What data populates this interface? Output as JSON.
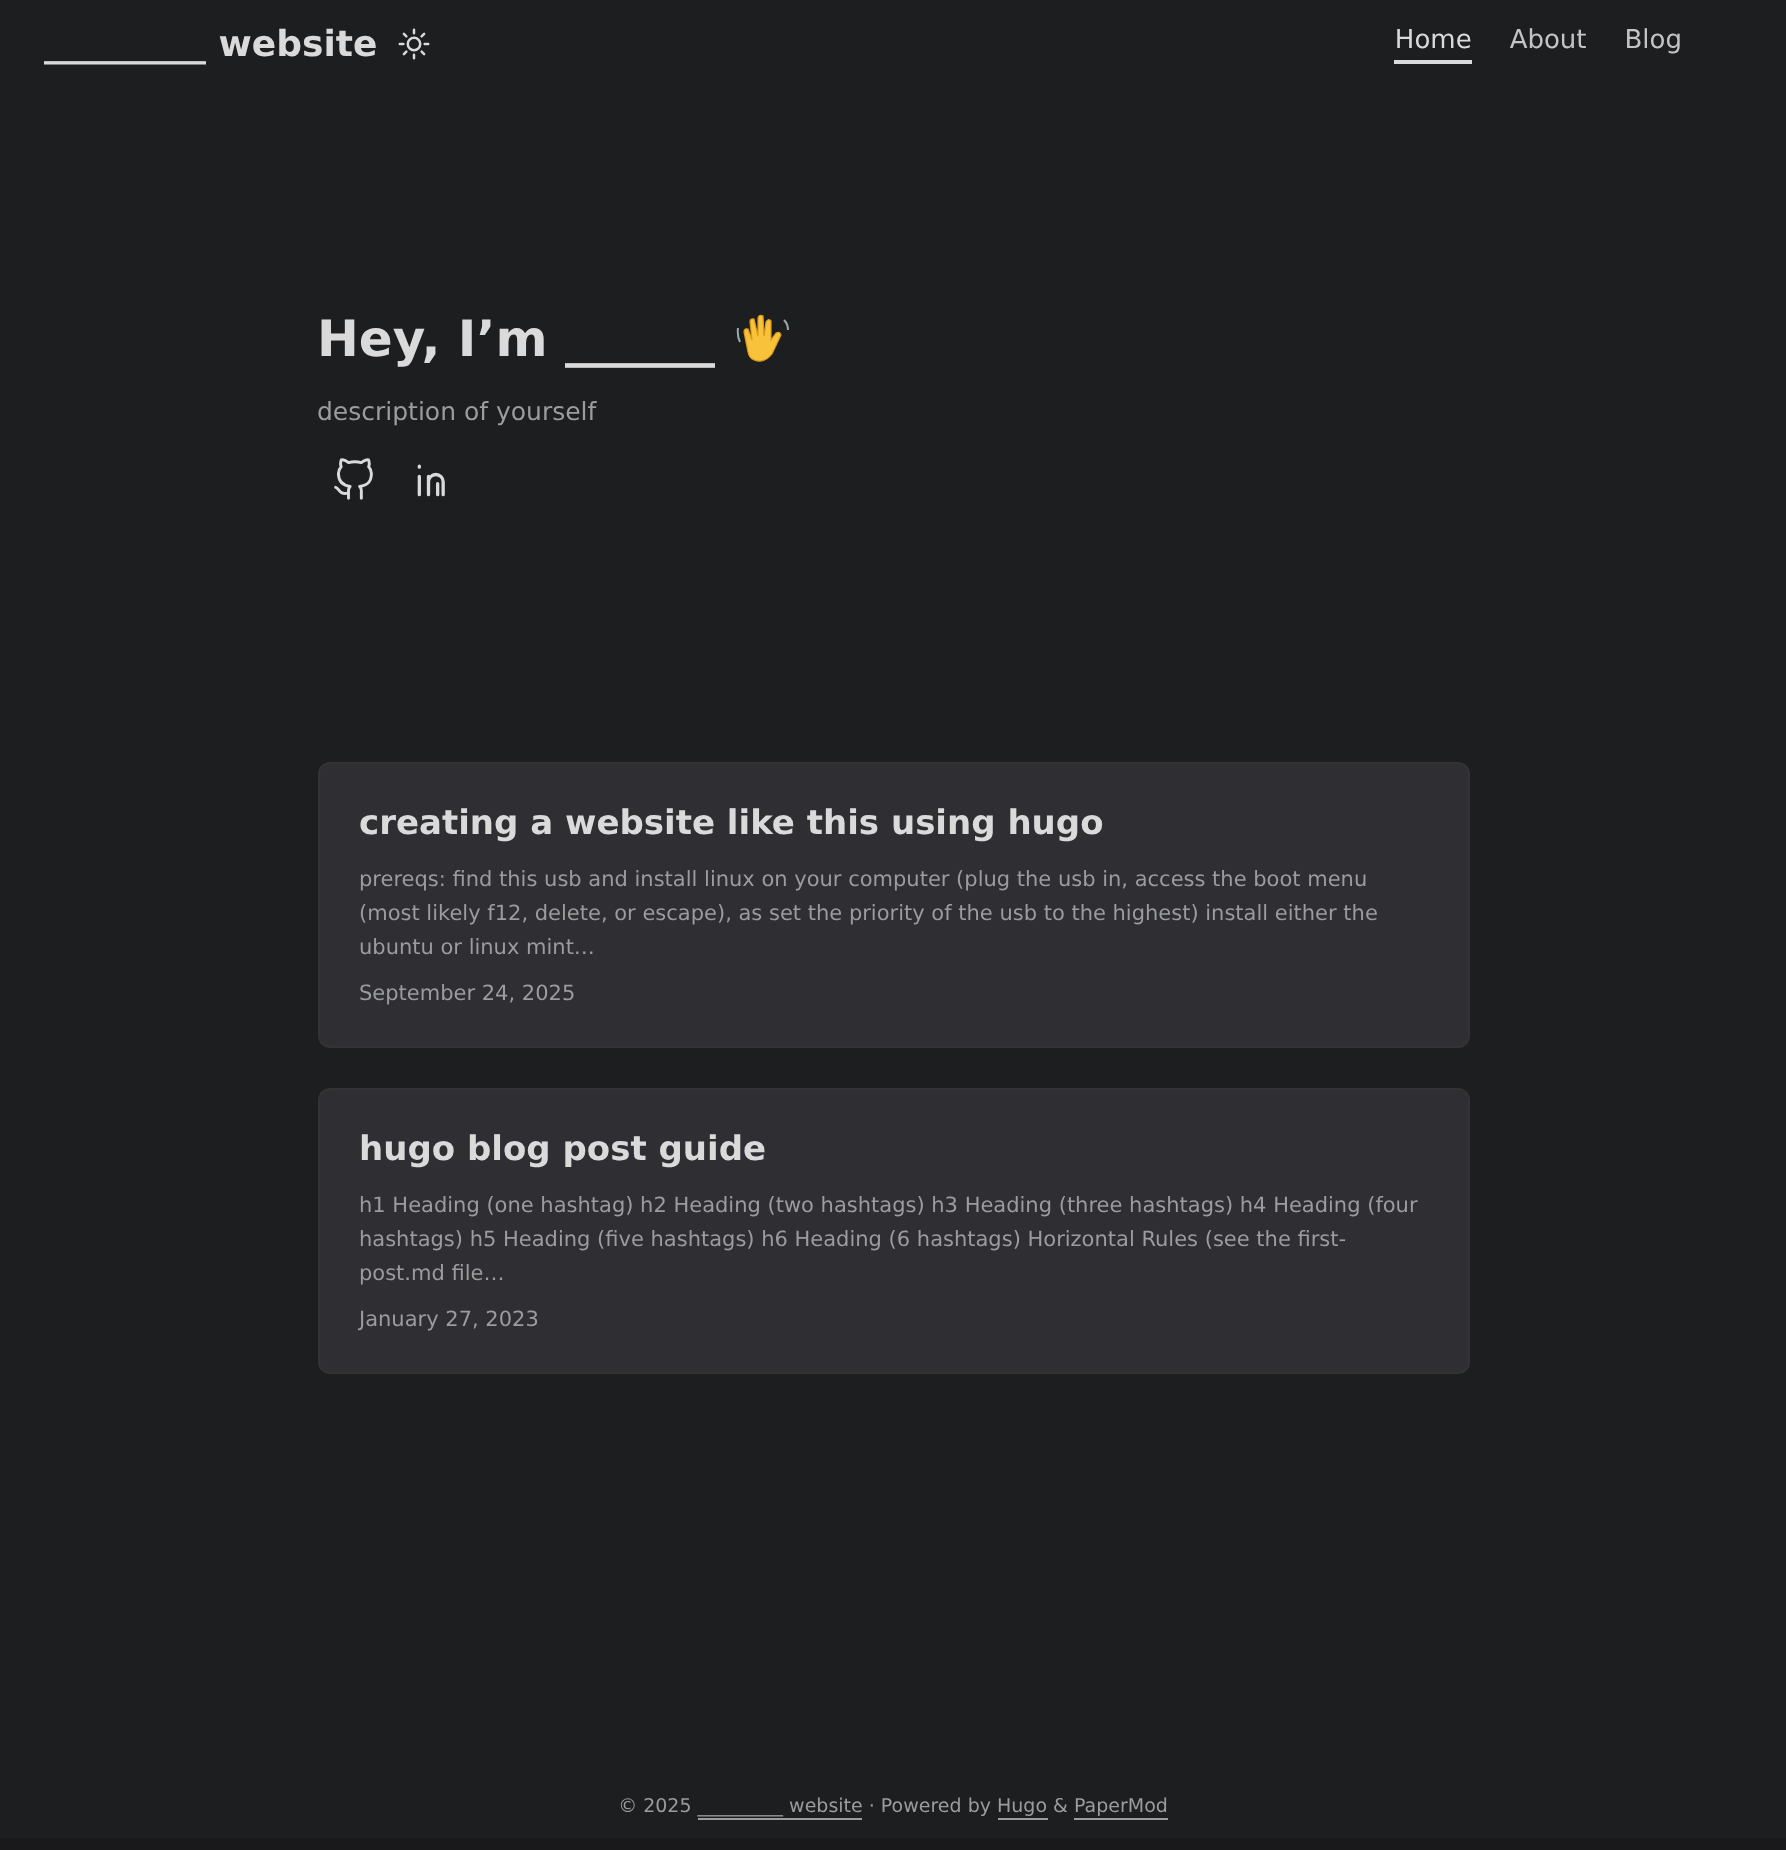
{
  "header": {
    "logo": "_________ website",
    "nav": [
      {
        "label": "Home",
        "selected": true
      },
      {
        "label": "About",
        "selected": false
      },
      {
        "label": "Blog",
        "selected": false
      }
    ]
  },
  "hero": {
    "title": "Hey, I’m ______",
    "description": "description of yourself"
  },
  "posts": [
    {
      "title": "creating a website like this using hugo",
      "excerpt": "prereqs: find this usb and install linux on your computer (plug the usb in, access the boot menu (most likely f12, delete, or escape), as set the priority of the usb to the highest) install either the ubuntu or linux mint…",
      "date": "September 24, 2025"
    },
    {
      "title": "hugo blog post guide",
      "excerpt": "h1 Heading (one hashtag) h2 Heading (two hashtags) h3 Heading (three hashtags) h4 Heading (four hashtags) h5 Heading (five hashtags) h6 Heading (6 hashtags) Horizontal Rules (see the first-post.md file…",
      "date": "January 27, 2023"
    }
  ],
  "footer": {
    "copyright": "© 2025",
    "site_link": "_________ website",
    "powered": "· Powered by",
    "hugo_link": "Hugo",
    "amp": "&",
    "theme_link": "PaperMod"
  }
}
